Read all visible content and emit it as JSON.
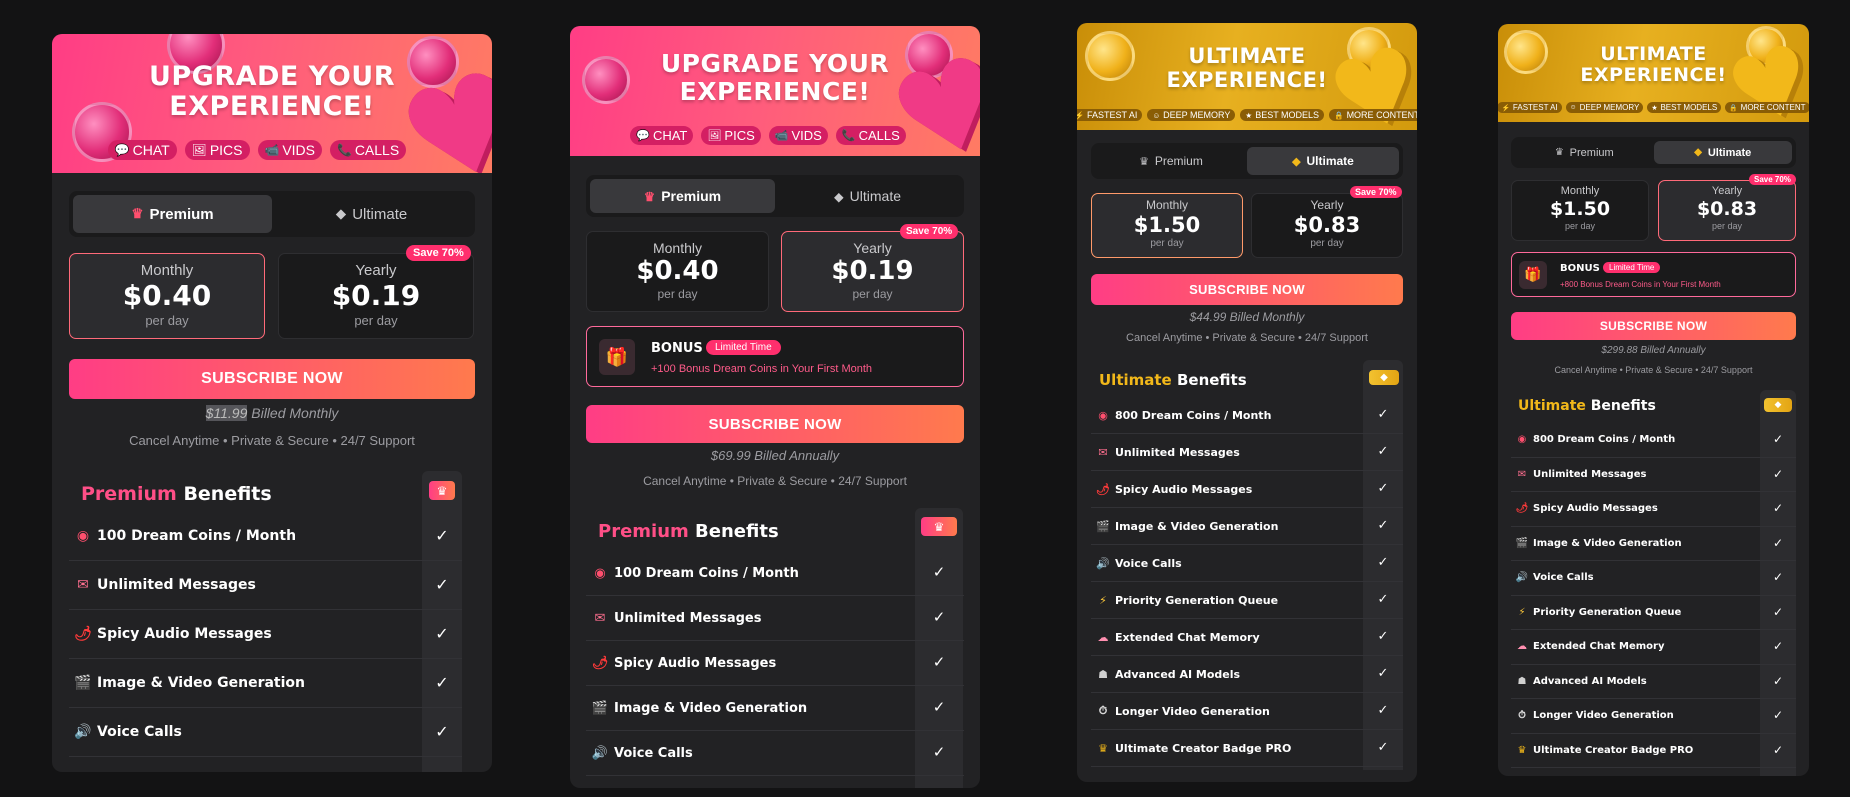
{
  "cards": [
    {
      "banner": {
        "line1": "UPGRADE YOUR",
        "line2": "EXPERIENCE!",
        "chips": [
          "CHAT",
          "PICS",
          "VIDS",
          "CALLS"
        ]
      },
      "tabs": [
        "Premium",
        "Ultimate"
      ],
      "prices": [
        {
          "label": "Monthly",
          "amount": "$0.40",
          "unit": "per day"
        },
        {
          "label": "Yearly",
          "amount": "$0.19",
          "unit": "per day",
          "save": "Save 70%"
        }
      ],
      "subscribe": "SUBSCRIBE NOW",
      "billed_amount": "$11.99",
      "billed_rest": " Billed Monthly",
      "fine": "Cancel Anytime • Private & Secure • 24/7 Support",
      "benefits_accent": "Premium",
      "benefits_word": " Benefits",
      "benefits": [
        "100 Dream Coins / Month",
        "Unlimited Messages",
        "Spicy Audio Messages",
        "Image & Video Generation",
        "Voice Calls"
      ]
    },
    {
      "banner": {
        "line1": "UPGRADE YOUR",
        "line2": "EXPERIENCE!",
        "chips": [
          "CHAT",
          "PICS",
          "VIDS",
          "CALLS"
        ]
      },
      "tabs": [
        "Premium",
        "Ultimate"
      ],
      "prices": [
        {
          "label": "Monthly",
          "amount": "$0.40",
          "unit": "per day"
        },
        {
          "label": "Yearly",
          "amount": "$0.19",
          "unit": "per day",
          "save": "Save 70%"
        }
      ],
      "bonus": {
        "title": "BONUS",
        "badge": "Limited Time",
        "desc": "+100 Bonus Dream Coins in Your First Month"
      },
      "subscribe": "SUBSCRIBE NOW",
      "billed": "$69.99 Billed Annually",
      "fine": "Cancel Anytime • Private & Secure • 24/7 Support",
      "benefits_accent": "Premium",
      "benefits_word": " Benefits",
      "benefits": [
        "100 Dream Coins / Month",
        "Unlimited Messages",
        "Spicy Audio Messages",
        "Image & Video Generation",
        "Voice Calls"
      ]
    },
    {
      "banner": {
        "line1": "ULTIMATE",
        "line2": "EXPERIENCE!",
        "chips": [
          "FASTEST AI",
          "DEEP MEMORY",
          "BEST MODELS",
          "MORE CONTENT"
        ]
      },
      "tabs": [
        "Premium",
        "Ultimate"
      ],
      "prices": [
        {
          "label": "Monthly",
          "amount": "$1.50",
          "unit": "per day"
        },
        {
          "label": "Yearly",
          "amount": "$0.83",
          "unit": "per day",
          "save": "Save 70%"
        }
      ],
      "subscribe": "SUBSCRIBE NOW",
      "billed": "$44.99 Billed Monthly",
      "fine": "Cancel Anytime • Private & Secure • 24/7 Support",
      "benefits_accent": "Ultimate",
      "benefits_word": " Benefits",
      "benefits": [
        "800 Dream Coins / Month",
        "Unlimited Messages",
        "Spicy Audio Messages",
        "Image & Video Generation",
        "Voice Calls",
        "Priority Generation Queue",
        "Extended Chat Memory",
        "Advanced AI Models",
        "Longer Video Generation",
        "Ultimate Creator Badge PRO"
      ]
    },
    {
      "banner": {
        "line1": "ULTIMATE",
        "line2": "EXPERIENCE!",
        "chips": [
          "FASTEST AI",
          "DEEP MEMORY",
          "BEST MODELS",
          "MORE CONTENT"
        ]
      },
      "tabs": [
        "Premium",
        "Ultimate"
      ],
      "prices": [
        {
          "label": "Monthly",
          "amount": "$1.50",
          "unit": "per day"
        },
        {
          "label": "Yearly",
          "amount": "$0.83",
          "unit": "per day",
          "save": "Save 70%"
        }
      ],
      "bonus": {
        "title": "BONUS",
        "badge": "Limited Time",
        "desc": "+800 Bonus Dream Coins in Your First Month"
      },
      "subscribe": "SUBSCRIBE NOW",
      "billed": "$299.88 Billed Annually",
      "fine": "Cancel Anytime • Private & Secure • 24/7 Support",
      "benefits_accent": "Ultimate",
      "benefits_word": " Benefits",
      "benefits": [
        "800 Dream Coins / Month",
        "Unlimited Messages",
        "Spicy Audio Messages",
        "Image & Video Generation",
        "Voice Calls",
        "Priority Generation Queue",
        "Extended Chat Memory",
        "Advanced AI Models",
        "Longer Video Generation",
        "Ultimate Creator Badge PRO"
      ]
    }
  ],
  "icons": {
    "chips_premium": [
      "chat-bubble-icon",
      "picture-icon",
      "video-icon",
      "phone-icon"
    ],
    "chips_ultimate": [
      "lightning-icon",
      "brain-icon",
      "star-icon",
      "lock-icon"
    ],
    "tabs": [
      "crown-icon",
      "diamond-icon"
    ],
    "benefits": [
      "coin-icon",
      "envelope-icon",
      "chili-icon",
      "clapper-icon",
      "speaker-icon",
      "lightning-icon",
      "brain-icon",
      "robot-icon",
      "stopwatch-icon",
      "crown-icon"
    ]
  },
  "colors": {
    "accent_pink": "#ff4f87",
    "accent_gold": "#f2b81a",
    "card_bg": "#222224",
    "page_bg": "#131314"
  }
}
